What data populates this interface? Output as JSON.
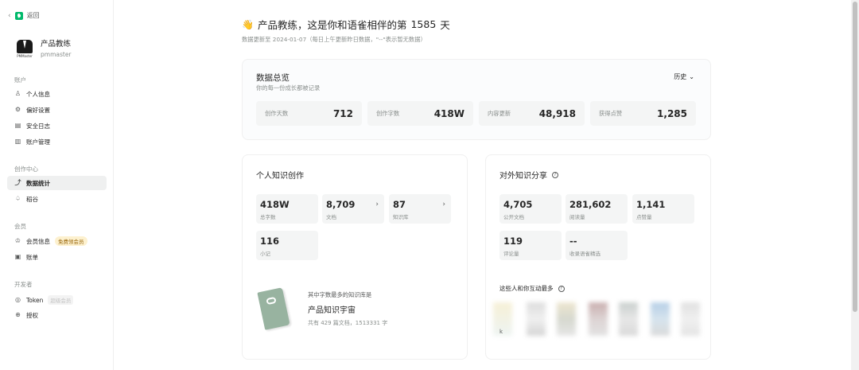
{
  "sidebar": {
    "back_label": "返回",
    "profile": {
      "name": "产品教练",
      "handle": "pmmaster",
      "avatar_caption": "PMMaster"
    },
    "sections": [
      {
        "title": "账户",
        "items": [
          {
            "label": "个人信息",
            "icon": "user-icon"
          },
          {
            "label": "偏好设置",
            "icon": "gear-icon"
          },
          {
            "label": "安全日志",
            "icon": "log-icon"
          },
          {
            "label": "账户管理",
            "icon": "account-icon"
          }
        ]
      },
      {
        "title": "创作中心",
        "items": [
          {
            "label": "数据统计",
            "icon": "chart-icon",
            "active": true
          },
          {
            "label": "稻谷",
            "icon": "rice-icon"
          }
        ]
      },
      {
        "title": "会员",
        "items": [
          {
            "label": "会员信息",
            "icon": "crown-icon",
            "badge": "免费领会员"
          },
          {
            "label": "账单",
            "icon": "bill-icon"
          }
        ]
      },
      {
        "title": "开发者",
        "items": [
          {
            "label": "Token",
            "icon": "token-icon",
            "badge": "超级会员"
          },
          {
            "label": "授权",
            "icon": "auth-icon"
          }
        ]
      }
    ]
  },
  "header": {
    "emoji": "👋",
    "headline_prefix": "产品教练，这是你和语雀相伴的第",
    "days": "1585",
    "headline_suffix": "天",
    "subline": "数据更新至 2024-01-07（每日上午更新昨日数据，\"--\"表示暂无数据）"
  },
  "overview": {
    "title": "数据总览",
    "desc": "你的每一份成长都被记录",
    "history_label": "历史",
    "stats": [
      {
        "label": "创作天数",
        "value": "712"
      },
      {
        "label": "创作字数",
        "value": "418W"
      },
      {
        "label": "内容更新",
        "value": "48,918"
      },
      {
        "label": "获得点赞",
        "value": "1,285"
      }
    ]
  },
  "personal": {
    "title": "个人知识创作",
    "tiles": [
      {
        "value": "418W",
        "label": "总字数"
      },
      {
        "value": "8,709",
        "label": "文档",
        "link": true
      },
      {
        "value": "87",
        "label": "知识库",
        "link": true
      },
      {
        "value": "116",
        "label": "小记"
      }
    ],
    "most": {
      "label": "其中字数最多的知识库是",
      "name": "产品知识宇宙",
      "meta": "共有 429 篇文档，1513331 字"
    }
  },
  "sharing": {
    "title": "对外知识分享",
    "tiles": [
      {
        "value": "4,705",
        "label": "公开文档"
      },
      {
        "value": "281,602",
        "label": "阅读量"
      },
      {
        "value": "1,141",
        "label": "点赞量"
      },
      {
        "value": "119",
        "label": "评论量"
      },
      {
        "value": "--",
        "label": "收录语雀精选"
      }
    ],
    "interact_label": "这些人和你互动最多",
    "interact_initial": "k"
  }
}
